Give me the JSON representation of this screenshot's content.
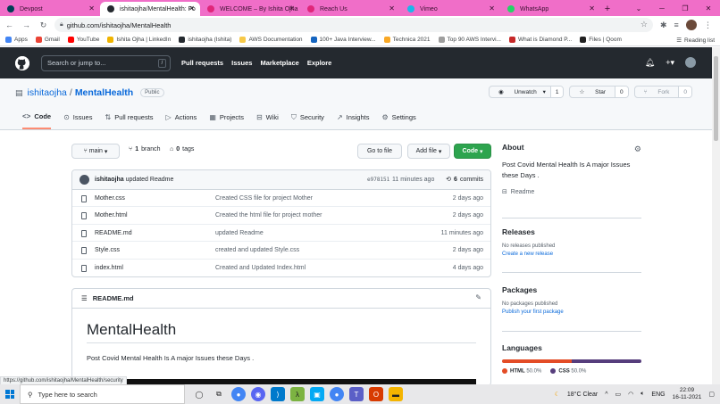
{
  "browser": {
    "tabs": [
      {
        "title": "Devpost",
        "color": "#003e54",
        "active": false
      },
      {
        "title": "ishitaojha/MentalHealth: Fo",
        "color": "#24292f",
        "active": true
      },
      {
        "title": "WELCOME – By Ishita Ojha",
        "color": "#e0267a",
        "active": false
      },
      {
        "title": "Reach Us",
        "color": "#e0267a",
        "active": false
      },
      {
        "title": "Vimeo",
        "color": "#1ab7ea",
        "active": false
      },
      {
        "title": "WhatsApp",
        "color": "#25d366",
        "active": false
      }
    ],
    "url": "github.com/ishitaojha/MentalHealth",
    "bookmarks": [
      "Apps",
      "Gmail",
      "YouTube",
      "Ishita Ojha | LinkedIn",
      "ishitaojha (Ishita)",
      "AWS Documentation",
      "100+ Java Interview...",
      "Technica 2021",
      "Top 90 AWS Intervi...",
      "What is Diamond P...",
      "Files | Qoom"
    ],
    "reading_list": "Reading list",
    "status_url": "https://github.com/ishitaojha/MentalHealth/security"
  },
  "github": {
    "search_placeholder": "Search or jump to...",
    "search_key": "/",
    "nav": [
      "Pull requests",
      "Issues",
      "Marketplace",
      "Explore"
    ]
  },
  "repo": {
    "owner": "ishitaojha",
    "separator": "/",
    "name": "MentalHealth",
    "visibility": "Public",
    "unwatch": "Unwatch",
    "unwatch_count": "1",
    "star": "Star",
    "star_count": "0",
    "fork": "Fork",
    "fork_count": "0",
    "tabs": [
      {
        "label": "Code",
        "icon": "code-icon",
        "glyph": "<>"
      },
      {
        "label": "Issues",
        "icon": "issue-icon",
        "glyph": "⊙"
      },
      {
        "label": "Pull requests",
        "icon": "pull-request-icon",
        "glyph": "⇅"
      },
      {
        "label": "Actions",
        "icon": "play-icon",
        "glyph": "▷"
      },
      {
        "label": "Projects",
        "icon": "project-icon",
        "glyph": "▦"
      },
      {
        "label": "Wiki",
        "icon": "book-icon",
        "glyph": "⊟"
      },
      {
        "label": "Security",
        "icon": "shield-icon",
        "glyph": "⛉"
      },
      {
        "label": "Insights",
        "icon": "graph-icon",
        "glyph": "↗"
      },
      {
        "label": "Settings",
        "icon": "gear-icon",
        "glyph": "⚙"
      }
    ]
  },
  "toolbar": {
    "branch": "main",
    "branches_count": "1",
    "branches_label": "branch",
    "tags_count": "0",
    "tags_label": "tags",
    "go_to_file": "Go to file",
    "add_file": "Add file",
    "code": "Code"
  },
  "commit": {
    "author": "ishitaojha",
    "message": "updated Readme",
    "hash": "e978151",
    "time": "11 minutes ago",
    "count": "6",
    "count_label": "commits"
  },
  "files": [
    {
      "name": "Mother.css",
      "message": "Created CSS file for project Mother",
      "age": "2 days ago"
    },
    {
      "name": "Mother.html",
      "message": "Created the html file for project mother",
      "age": "2 days ago"
    },
    {
      "name": "README.md",
      "message": "updated Readme",
      "age": "11 minutes ago"
    },
    {
      "name": "Style.css",
      "message": "created and updated Style.css",
      "age": "2 days ago"
    },
    {
      "name": "index.html",
      "message": "Created and Updated Index.html",
      "age": "4 days ago"
    }
  ],
  "readme": {
    "filename": "README.md",
    "heading": "MentalHealth",
    "body": "Post Covid Mental Health Is A major Issues these Days ."
  },
  "sidebar": {
    "about_title": "About",
    "about_text": "Post Covid Mental Health Is A major Issues these Days .",
    "readme_link": "Readme",
    "releases_title": "Releases",
    "releases_empty": "No releases published",
    "releases_link": "Create a new release",
    "packages_title": "Packages",
    "packages_empty": "No packages published",
    "packages_link": "Publish your first package",
    "languages_title": "Languages",
    "languages": [
      {
        "name": "HTML",
        "percent": 50.0,
        "percent_label": "50.0%",
        "color": "#e34c26"
      },
      {
        "name": "CSS",
        "percent": 50.0,
        "percent_label": "50.0%",
        "color": "#563d7c"
      }
    ]
  },
  "taskbar": {
    "search_placeholder": "Type here to search",
    "weather": "18°C  Clear",
    "lang": "ENG",
    "time": "22:09",
    "date": "16-11-2021"
  }
}
